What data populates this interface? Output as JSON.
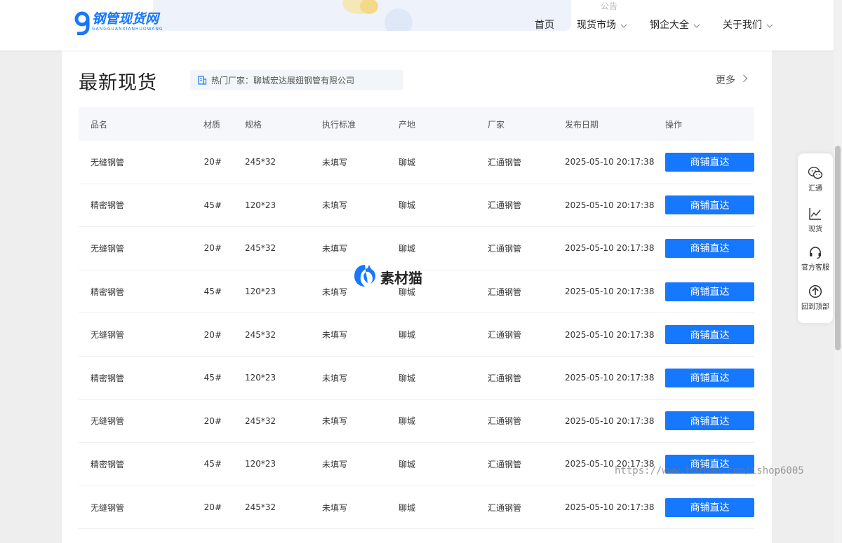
{
  "header": {
    "logo_cn": "钢管现货网",
    "logo_pinyin": "GANGGUANXIANHUOWANG",
    "notice": "公告",
    "nav": [
      {
        "label": "首页",
        "dropdown": false
      },
      {
        "label": "现货市场",
        "dropdown": true
      },
      {
        "label": "钢企大全",
        "dropdown": true
      },
      {
        "label": "关于我们",
        "dropdown": true
      }
    ]
  },
  "section": {
    "title": "最新现货",
    "hot_maker": "热门厂家：聊城宏达展翅钢管有限公司",
    "more": "更多"
  },
  "table": {
    "columns": [
      "品名",
      "材质",
      "规格",
      "执行标准",
      "产地",
      "厂家",
      "发布日期",
      "操作"
    ],
    "rows": [
      {
        "name": "无缝钢管",
        "material": "20#",
        "spec": "245*32",
        "standard": "未填写",
        "origin": "聊城",
        "maker": "汇通钢管",
        "date": "2025-05-10 20:17:38",
        "action": "商铺直达"
      },
      {
        "name": "精密钢管",
        "material": "45#",
        "spec": "120*23",
        "standard": "未填写",
        "origin": "聊城",
        "maker": "汇通钢管",
        "date": "2025-05-10 20:17:38",
        "action": "商铺直达"
      },
      {
        "name": "无缝钢管",
        "material": "20#",
        "spec": "245*32",
        "standard": "未填写",
        "origin": "聊城",
        "maker": "汇通钢管",
        "date": "2025-05-10 20:17:38",
        "action": "商铺直达"
      },
      {
        "name": "精密钢管",
        "material": "45#",
        "spec": "120*23",
        "standard": "未填写",
        "origin": "聊城",
        "maker": "汇通钢管",
        "date": "2025-05-10 20:17:38",
        "action": "商铺直达"
      },
      {
        "name": "无缝钢管",
        "material": "20#",
        "spec": "245*32",
        "standard": "未填写",
        "origin": "聊城",
        "maker": "汇通钢管",
        "date": "2025-05-10 20:17:38",
        "action": "商铺直达"
      },
      {
        "name": "精密钢管",
        "material": "45#",
        "spec": "120*23",
        "standard": "未填写",
        "origin": "聊城",
        "maker": "汇通钢管",
        "date": "2025-05-10 20:17:38",
        "action": "商铺直达"
      },
      {
        "name": "无缝钢管",
        "material": "20#",
        "spec": "245*32",
        "standard": "未填写",
        "origin": "聊城",
        "maker": "汇通钢管",
        "date": "2025-05-10 20:17:38",
        "action": "商铺直达"
      },
      {
        "name": "精密钢管",
        "material": "45#",
        "spec": "120*23",
        "standard": "未填写",
        "origin": "聊城",
        "maker": "汇通钢管",
        "date": "2025-05-10 20:17:38",
        "action": "商铺直达"
      },
      {
        "name": "无缝钢管",
        "material": "20#",
        "spec": "245*32",
        "standard": "未填写",
        "origin": "聊城",
        "maker": "汇通钢管",
        "date": "2025-05-10 20:17:38",
        "action": "商铺直达"
      }
    ]
  },
  "float_bar": [
    {
      "label": "汇通",
      "icon": "wechat-icon"
    },
    {
      "label": "现货",
      "icon": "chart-line-icon"
    },
    {
      "label": "官方客服",
      "icon": "headset-icon"
    },
    {
      "label": "回到顶部",
      "icon": "arrow-up-circle-icon"
    }
  ],
  "watermarks": {
    "brand": "素材猫",
    "url": "https://www.huzhan.com/ishop6005"
  },
  "colors": {
    "primary": "#1677ff",
    "header_bg": "#ffffff",
    "page_bg": "#eeeeee",
    "table_head_bg": "#f5f7fa"
  }
}
